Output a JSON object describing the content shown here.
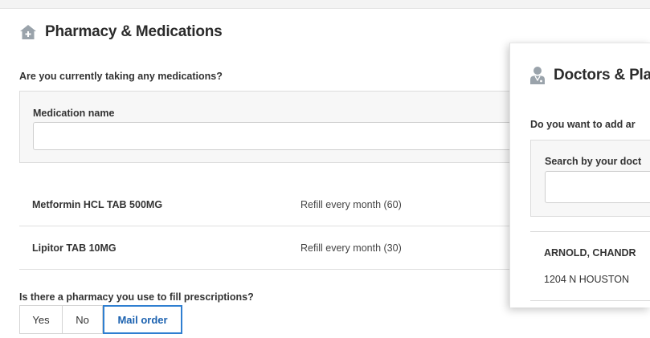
{
  "pharmacy": {
    "title": "Pharmacy & Medications",
    "question_meds": "Are you currently taking any medications?",
    "medication_label": "Medication name",
    "medication_value": "",
    "medications": [
      {
        "name": "Metformin HCL TAB 500MG",
        "refill": "Refill every month (60)"
      },
      {
        "name": "Lipitor TAB 10MG",
        "refill": "Refill every month (30)"
      }
    ],
    "question_pharmacy": "Is there a pharmacy you use to fill prescriptions?",
    "options": [
      "Yes",
      "No",
      "Mail order"
    ],
    "selected_option": "Mail order"
  },
  "doctors": {
    "title": "Doctors & Pla",
    "question": "Do you want to add ar",
    "search_label": "Search by your doct",
    "search_value": "",
    "result": {
      "name": "ARNOLD, CHANDR",
      "address": "1204 N HOUSTON"
    }
  },
  "colors": {
    "accent": "#2f7fd1",
    "icon_gray": "#9aa3ab"
  },
  "icons": {
    "pharmacy": "home-plus-icon",
    "doctors": "doctor-icon"
  }
}
